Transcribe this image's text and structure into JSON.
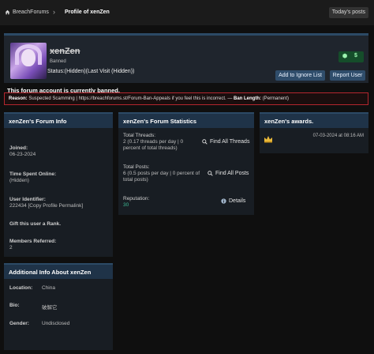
{
  "header": {
    "breadcrumb_home": "BreachForums",
    "breadcrumb_sep": "›",
    "breadcrumb_current": "Profile of xenZen",
    "todays_posts": "Today's posts"
  },
  "profile": {
    "username": "xenZen",
    "rank": "Banned",
    "status": "Status:(Hidden)(Last Visit (Hidden))",
    "add_ignore": "Add to Ignore List",
    "report_user": "Report User",
    "badge_left": "⬢",
    "badge_right": "$"
  },
  "ban": {
    "title": "This forum account is currently banned.",
    "reason_label": "Reason:",
    "reason_text": "Suspected Scamming | https://breachforums.st/Forum-Ban-Appeals if you feel this is incorrect. —",
    "length_label": "Ban Length:",
    "length_value": "(Permanent)"
  },
  "forum_info": {
    "title": "xenZen's Forum Info",
    "joined_label": "Joined:",
    "joined_value": "06-23-2024",
    "time_label": "Time Spent Online:",
    "time_value": "(Hidden)",
    "uid_label": "User Identifier:",
    "uid_value": "222434 [Copy Profile Permalink]",
    "gift_label": "Gift this user a Rank.",
    "referred_label": "Members Referred:",
    "referred_value": "2"
  },
  "stats": {
    "title": "xenZen's Forum Statistics",
    "threads_label": "Total Threads:",
    "threads_value": "2 (0.17 threads per day | 0 percent of total threads)",
    "find_threads": "Find All Threads",
    "posts_label": "Total Posts:",
    "posts_value": "6 (0.5 posts per day | 0 percent of total posts)",
    "find_posts": "Find All Posts",
    "rep_label": "Reputation:",
    "rep_value": "30",
    "details": "Details"
  },
  "awards": {
    "title": "xenZen's awards.",
    "date": "07-03-2024 at 08:16 AM",
    "icon": "crown-icon"
  },
  "additional": {
    "title": "Additional Info About xenZen",
    "location_label": "Location:",
    "location_value": "China",
    "bio_label": "Bio:",
    "bio_value": "破解它",
    "gender_label": "Gender:",
    "gender_value": "Undisclosed"
  },
  "colors": {
    "accent": "#2c4a66",
    "ban_border": "#b4262e",
    "reputation": "#3dbb96"
  }
}
